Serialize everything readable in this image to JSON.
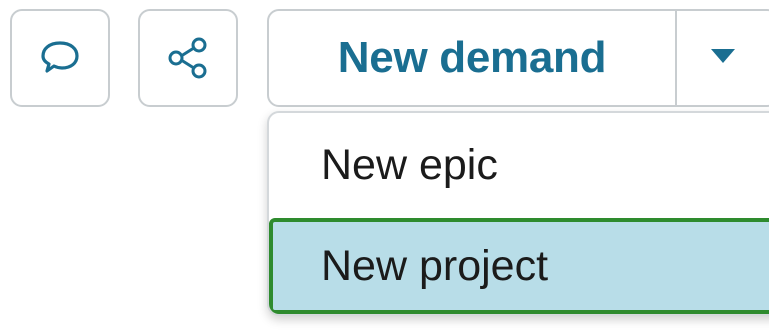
{
  "toolbar": {
    "comment_icon": "speech-bubble-icon",
    "share_icon": "share-nodes-icon",
    "primary_action_label": "New demand",
    "dropdown_icon": "caret-down-icon",
    "accent_color": "#1a6e91",
    "border_color": "#c8cdd0"
  },
  "dropdown_menu": {
    "items": [
      {
        "label": "New epic",
        "highlighted": false
      },
      {
        "label": "New project",
        "highlighted": true
      }
    ],
    "highlight_background": "#b8dde8",
    "highlight_border": "#2e8b2e"
  }
}
